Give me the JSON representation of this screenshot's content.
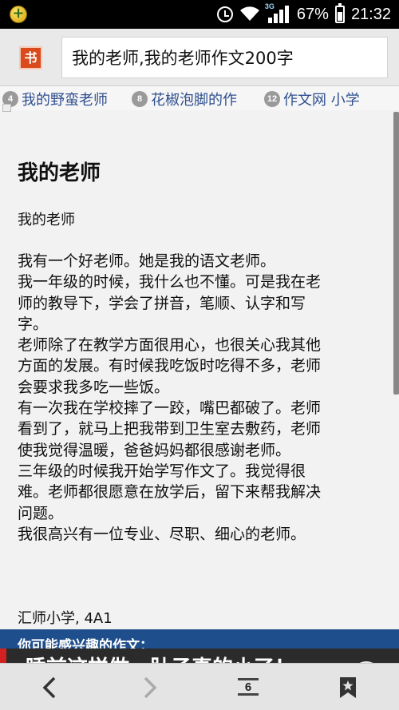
{
  "status_bar": {
    "network": "3G",
    "battery_percent": 67,
    "battery_text": "67%",
    "time": "21:32",
    "icons": [
      "app-notification-icon",
      "alarm-icon",
      "wifi-icon",
      "signal-icon",
      "battery-icon"
    ]
  },
  "address_bar": {
    "logo": "书",
    "url_text": "我的老师,我的老师作文200字"
  },
  "tabs": [
    {
      "num": "4",
      "label": "我的野蛮老师"
    },
    {
      "num": "8",
      "label": "花椒泡脚的作"
    },
    {
      "num": "12",
      "label": "作文网 小学"
    }
  ],
  "article": {
    "title": "我的老师",
    "subtitle": "我的老师",
    "lines": [
      "我有一个好老师。她是我的语文老师。",
      "我一年级的时候，我什么也不懂。可是我在老",
      "师的教导下，学会了拼音，笔顺、认字和写",
      "字。",
      "老师除了在教学方面很用心，也很关心我其他",
      "方面的发展。有时候我吃饭时吃得不多，老师",
      "会要求我多吃一些饭。",
      "有一次我在学校摔了一跤，嘴巴都破了。老师",
      "看到了，就马上把我带到卫生室去敷药，老师",
      "使我觉得温暖，爸爸妈妈都很感谢老师。",
      "三年级的时候我开始学写作文了。我觉得很",
      "难。老师都很愿意在放学后，留下来帮我解决",
      "问题。",
      "我很高兴有一位专业、尽职、细心的老师。"
    ],
    "footer": "汇师小学, 4A1"
  },
  "recommendation": {
    "heading": "你可能感兴趣的作文：",
    "item": "睡前这样做，肚子真的小了！"
  },
  "bottom_nav": {
    "tabs_count": "6",
    "icons": [
      "back-icon",
      "forward-icon",
      "tabs-icon",
      "bookmark-icon"
    ]
  }
}
